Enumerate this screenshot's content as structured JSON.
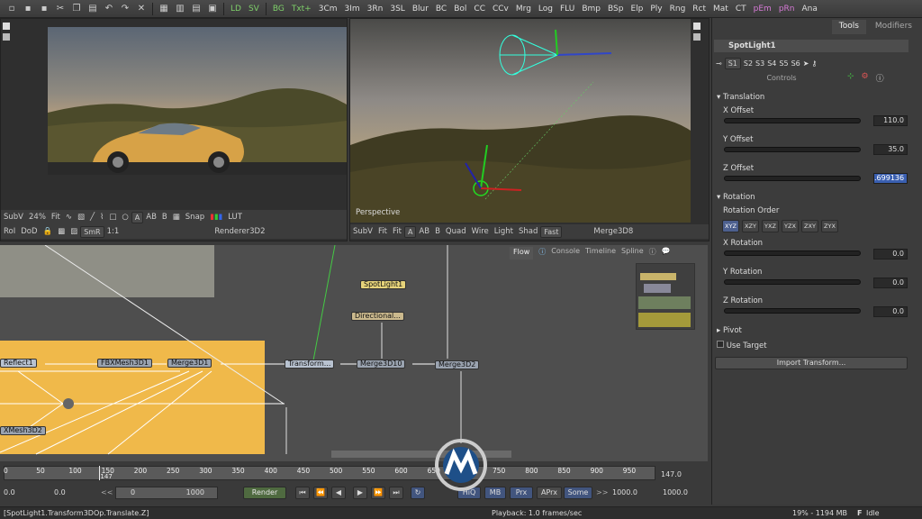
{
  "toolbar": {
    "tools": [
      "LD",
      "SV",
      "BG",
      "Txt+",
      "3Cm",
      "3Im",
      "3Rn",
      "3SL",
      "Blur",
      "BC",
      "Bol",
      "CC",
      "CCv",
      "Mrg",
      "Log",
      "FLU",
      "Bmp",
      "BSp",
      "Elp",
      "Ply",
      "Rng",
      "Rct",
      "Mat",
      "CT",
      "pEm",
      "pRn",
      "Ana"
    ]
  },
  "left_viewer": {
    "bar1": [
      "SubV",
      "24%",
      "Fit",
      "A",
      "B",
      "Snap",
      "LUT"
    ],
    "bar2": [
      "RoI",
      "DoD",
      "SmR",
      "1:1"
    ],
    "title": "Renderer3D2"
  },
  "right_viewer": {
    "label": "Perspective",
    "bar": [
      "SubV",
      "Fit",
      "Fit",
      "A",
      "B",
      "Quad",
      "Wire",
      "Light",
      "Shad",
      "Fast"
    ],
    "title": "Merge3D8"
  },
  "flow_tabs": [
    "Flow",
    "Console",
    "Timeline",
    "Spline"
  ],
  "nodes": {
    "spotlight": "SpotLight1",
    "directional": "Directional...",
    "reflect": "Reflect1",
    "fbxmesh": "FBXMesh3D1",
    "merge1": "Merge3D1",
    "transform": "Transform...",
    "merge10": "Merge3D10",
    "merge2": "Merge3D2",
    "xmesh": "XMesh3D2"
  },
  "panel": {
    "tabs": [
      "Tools",
      "Modifiers"
    ],
    "node_name": "SpotLight1",
    "subtabs": [
      "S1",
      "S2",
      "S3",
      "S4",
      "S5",
      "S6"
    ],
    "controls_label": "Controls",
    "translation": "Translation",
    "x_offset": {
      "label": "X Offset",
      "value": "110.0"
    },
    "y_offset": {
      "label": "Y Offset",
      "value": "35.0"
    },
    "z_offset": {
      "label": "Z Offset",
      "value": ".699136"
    },
    "rotation": "Rotation",
    "rotation_order": "Rotation Order",
    "orders": [
      "XYZ",
      "XZY",
      "YXZ",
      "YZX",
      "ZXY",
      "ZYX"
    ],
    "x_rot": {
      "label": "X Rotation",
      "value": "0.0"
    },
    "y_rot": {
      "label": "Y Rotation",
      "value": "0.0"
    },
    "z_rot": {
      "label": "Z Rotation",
      "value": "0.0"
    },
    "pivot": "Pivot",
    "use_target": "Use Target",
    "import_btn": "Import Transform..."
  },
  "timeline": {
    "ticks": [
      "0",
      "50",
      "100",
      "150",
      "200",
      "250",
      "300",
      "350",
      "400",
      "450",
      "500",
      "550",
      "600",
      "650",
      "700",
      "750",
      "800",
      "850",
      "900",
      "950"
    ],
    "current": "147",
    "end_value": "147.0",
    "start": "0.0",
    "start2": "0.0",
    "range_start": "0",
    "range_end": "1000",
    "render": "Render",
    "hiq": "HiQ",
    "mb": "MB",
    "prx": "Prx",
    "aprx": "APrx",
    "some": "Some",
    "end1": "1000.0",
    "end2": "1000.0"
  },
  "status": {
    "left": "[SpotLight1.Transform3DOp.Translate.Z]",
    "playback": "Playback: 1.0 frames/sec",
    "memory": "19% - 1194 MB",
    "state": "Idle"
  }
}
